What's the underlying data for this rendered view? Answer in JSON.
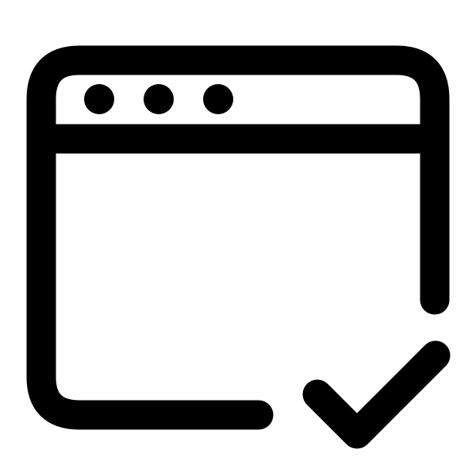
{
  "icon": {
    "name": "browser-window-check-icon",
    "stroke_color": "#000000",
    "background_color": "#ffffff",
    "parts": [
      "browser-window-outline",
      "title-bar-divider",
      "window-control-dots",
      "checkmark"
    ]
  }
}
